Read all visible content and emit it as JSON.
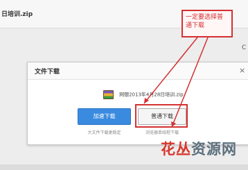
{
  "background": {
    "title": "日培训.zip",
    "edge_mark": "C"
  },
  "annotation": {
    "text": "一定要选择普通下载",
    "color": "#d43030"
  },
  "dialog": {
    "title": "文件下载",
    "close_label": "×",
    "file_icon": "archive-icon",
    "file_name": "网银2013年4月28日培训.zip",
    "buttons": {
      "fast_download": "加速下载",
      "normal_download": "普通下载"
    },
    "hints": {
      "fast": "大文件下载更稳定",
      "normal": "浏览器单线程下载"
    }
  },
  "watermark": {
    "part1": "花丛",
    "part2": "资源网"
  }
}
